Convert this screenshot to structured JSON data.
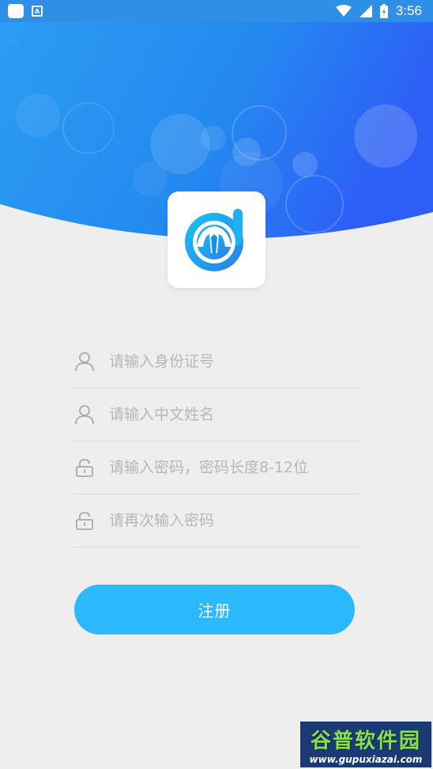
{
  "status_bar": {
    "time": "3:56",
    "left_icons": [
      "square-notification-icon",
      "app-a-notification-icon"
    ],
    "right_icons": [
      "wifi-icon",
      "cellular-signal-icon",
      "battery-icon"
    ]
  },
  "form": {
    "id_number_placeholder": "请输入身份证号",
    "name_placeholder": "请输入中文姓名",
    "password_placeholder": "请输入密码，密码长度8-12位",
    "confirm_password_placeholder": "请再次输入密码",
    "icons": [
      "user-icon",
      "user-icon",
      "lock-icon",
      "lock-icon"
    ]
  },
  "register_button_label": "注册",
  "watermark": {
    "title": "谷普软件园",
    "url": "www.gupuxiazai.com"
  },
  "colors": {
    "header_gradient_start": "#1e8ff0",
    "header_gradient_end": "#2a62f5",
    "button": "#2bb9fb",
    "background": "#eeeeee"
  }
}
